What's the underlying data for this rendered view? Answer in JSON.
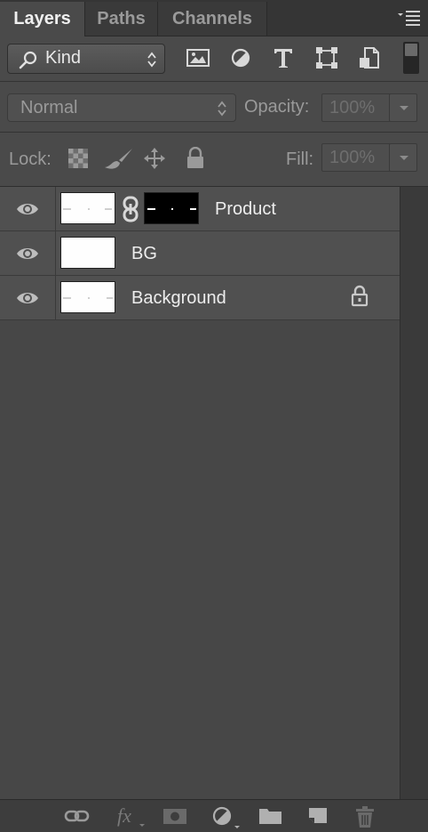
{
  "tabs": [
    {
      "label": "Layers",
      "active": true
    },
    {
      "label": "Paths",
      "active": false
    },
    {
      "label": "Channels",
      "active": false
    }
  ],
  "filter": {
    "kind_label": "Kind",
    "icons": [
      "image-filter-icon",
      "adjustment-filter-icon",
      "type-filter-icon",
      "shape-filter-icon",
      "smart-object-filter-icon"
    ]
  },
  "blend": {
    "mode": "Normal",
    "opacity_label": "Opacity:",
    "opacity_value": "100%"
  },
  "lock": {
    "label": "Lock:",
    "icons": [
      "lock-transparent-pixels-icon",
      "lock-image-pixels-icon",
      "lock-position-icon",
      "lock-all-icon"
    ],
    "fill_label": "Fill:",
    "fill_value": "100%"
  },
  "layers": [
    {
      "name": "Product",
      "visible": true,
      "has_mask": true,
      "locked": false
    },
    {
      "name": "BG",
      "visible": true,
      "has_mask": false,
      "locked": false
    },
    {
      "name": "Background",
      "visible": true,
      "has_mask": false,
      "locked": true
    }
  ],
  "bottom_toolbar": {
    "icons": [
      "link-layers-icon",
      "fx-icon",
      "add-mask-icon",
      "adjustment-layer-icon",
      "new-group-icon",
      "new-layer-icon",
      "delete-layer-icon"
    ]
  },
  "colors": {
    "panel_bg": "#434343",
    "active_tab": "#4a4a4a",
    "text_bright": "#ededed",
    "text_dim": "#9a9a9a"
  }
}
